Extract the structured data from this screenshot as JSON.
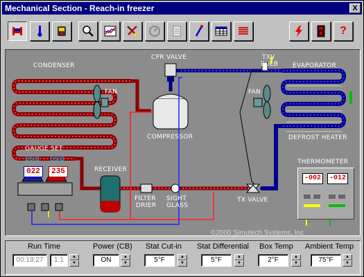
{
  "window": {
    "title": "Mechanical Section - Reach-in freezer",
    "close_label": "X"
  },
  "toolbar": {
    "buttons": [
      {
        "name": "bed-icon"
      },
      {
        "name": "thermometer-icon"
      },
      {
        "name": "meter-icon"
      },
      {
        "name": "magnifier-icon"
      },
      {
        "name": "graph-icon"
      },
      {
        "name": "tools-icon"
      },
      {
        "name": "gauge-dial-icon"
      },
      {
        "name": "document-icon"
      },
      {
        "name": "probe-icon"
      },
      {
        "name": "table-icon"
      },
      {
        "name": "heater-icon"
      },
      {
        "name": "lightning-icon"
      },
      {
        "name": "device-icon"
      },
      {
        "name": "help-icon",
        "label": "?"
      }
    ]
  },
  "diagram": {
    "labels": {
      "condenser": "CONDENSER",
      "fan_left": "FAN",
      "cpr_valve": "CPR VALVE",
      "txv_bulb_1": "TXV",
      "txv_bulb_2": "BULB",
      "evaporator": "EVAPORATOR",
      "fan_right": "FAN",
      "compressor": "COMPRESSOR",
      "defrost_heater": "DEFROST HEATER",
      "gauge_set": "GAUGE SET",
      "receiver": "RECEIVER",
      "filter_drier_1": "FILTER",
      "filter_drier_2": "DRIER",
      "sight_glass_1": "SIGHT",
      "sight_glass_2": "GLASS",
      "tx_valve": "TX VALVE",
      "thermometer": "THERMOMETER"
    },
    "gauges": {
      "low_unit": "psig",
      "high_unit": "psig",
      "low_value": "022",
      "high_value": "235"
    },
    "thermometer_readings": [
      "-002",
      "-012"
    ],
    "copyright": "©2000 Simutech Systems, Inc",
    "colors": {
      "hot_line": "#c00000",
      "cold_line": "#0000c0",
      "wire_red": "#ff2020",
      "wire_blue": "#2020ff",
      "background": "#8c8c8c"
    }
  },
  "controls": {
    "run_time": {
      "label": "Run Time",
      "value": "00:19:27",
      "speed": "1:1"
    },
    "power": {
      "label": "Power (CB)",
      "value": "ON"
    },
    "stat_cutin": {
      "label": "Stat Cut-in",
      "value": "5°F"
    },
    "stat_diff": {
      "label": "Stat Differential",
      "value": "5°F"
    },
    "box_temp": {
      "label": "Box Temp",
      "value": "2°F"
    },
    "ambient_temp": {
      "label": "Ambient Temp",
      "value": "75°F"
    }
  }
}
